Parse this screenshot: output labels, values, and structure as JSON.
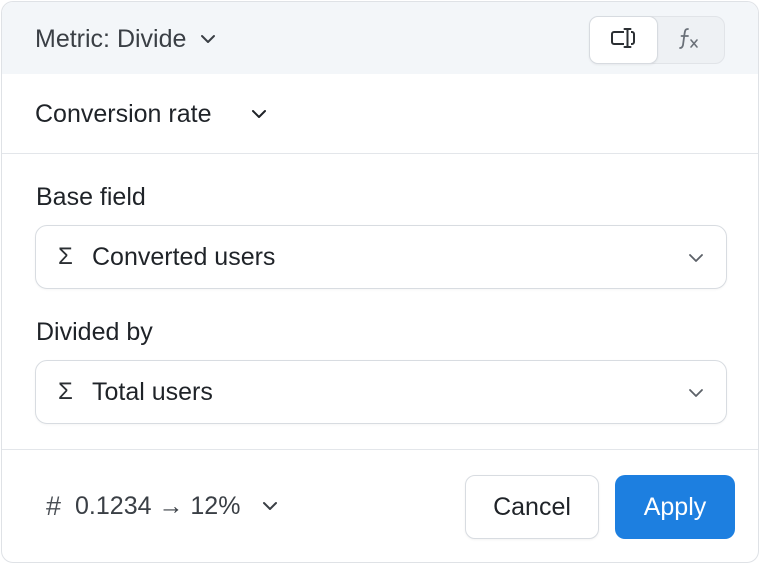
{
  "header": {
    "title": "Metric: Divide",
    "modes": [
      {
        "name": "builder-mode",
        "icon": "field-input-icon",
        "active": true
      },
      {
        "name": "formula-mode",
        "icon": "function-fx-icon",
        "active": false
      }
    ]
  },
  "metric": {
    "name": "Conversion rate"
  },
  "base_field": {
    "label": "Base field",
    "icon": "sigma-icon",
    "value": "Converted users"
  },
  "divided_by": {
    "label": "Divided by",
    "icon": "sigma-icon",
    "value": "Total users"
  },
  "footer": {
    "format_icon": "hash-icon",
    "format_example": "0.1234 → 12%",
    "cancel_label": "Cancel",
    "apply_label": "Apply"
  },
  "colors": {
    "accent": "#1d7fe0",
    "header_bg": "#f3f6f9",
    "border": "#d8dce1"
  }
}
